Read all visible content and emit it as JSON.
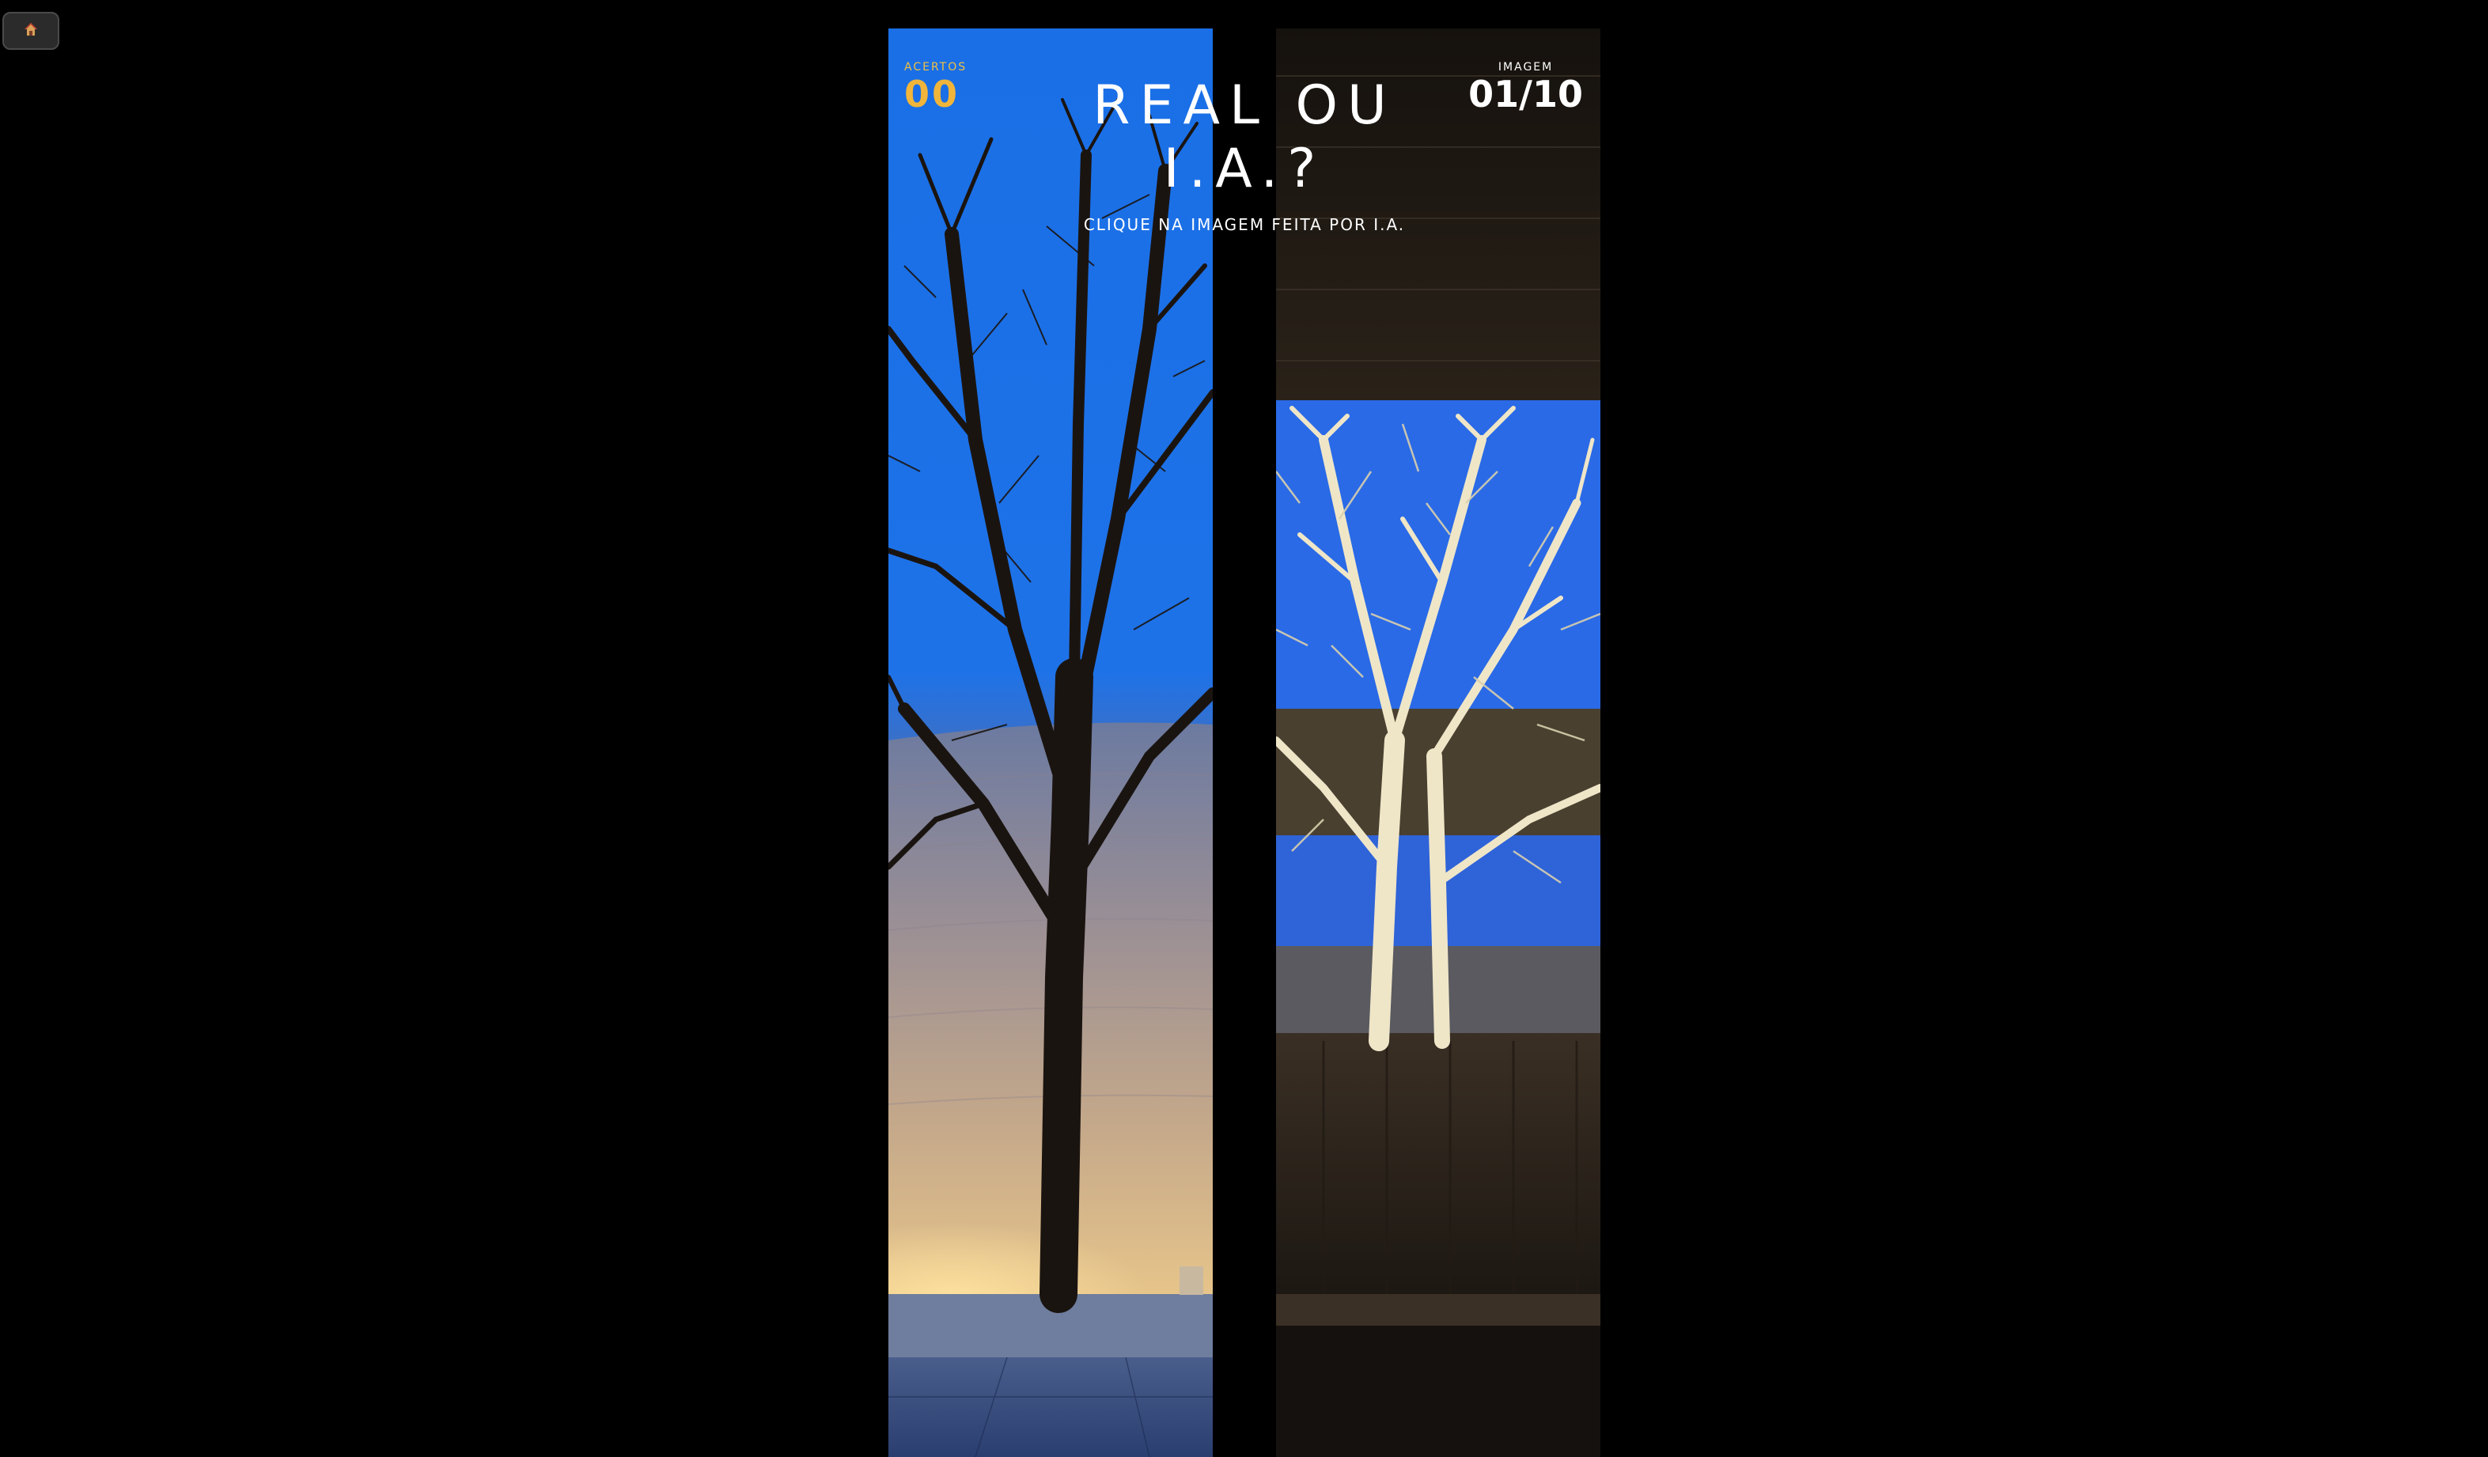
{
  "home": {
    "icon": "house-icon"
  },
  "hud": {
    "score_label": "ACERTOS",
    "score_value": "00",
    "image_label": "IMAGEM",
    "image_value": "01/10"
  },
  "header": {
    "title": "REAL OU I.A.?",
    "subtitle": "CLIQUE NA IMAGEM FEITA POR I.A."
  },
  "colors": {
    "background": "#000000",
    "accent": "#f0b53a",
    "sky": "#1f6fe0"
  }
}
